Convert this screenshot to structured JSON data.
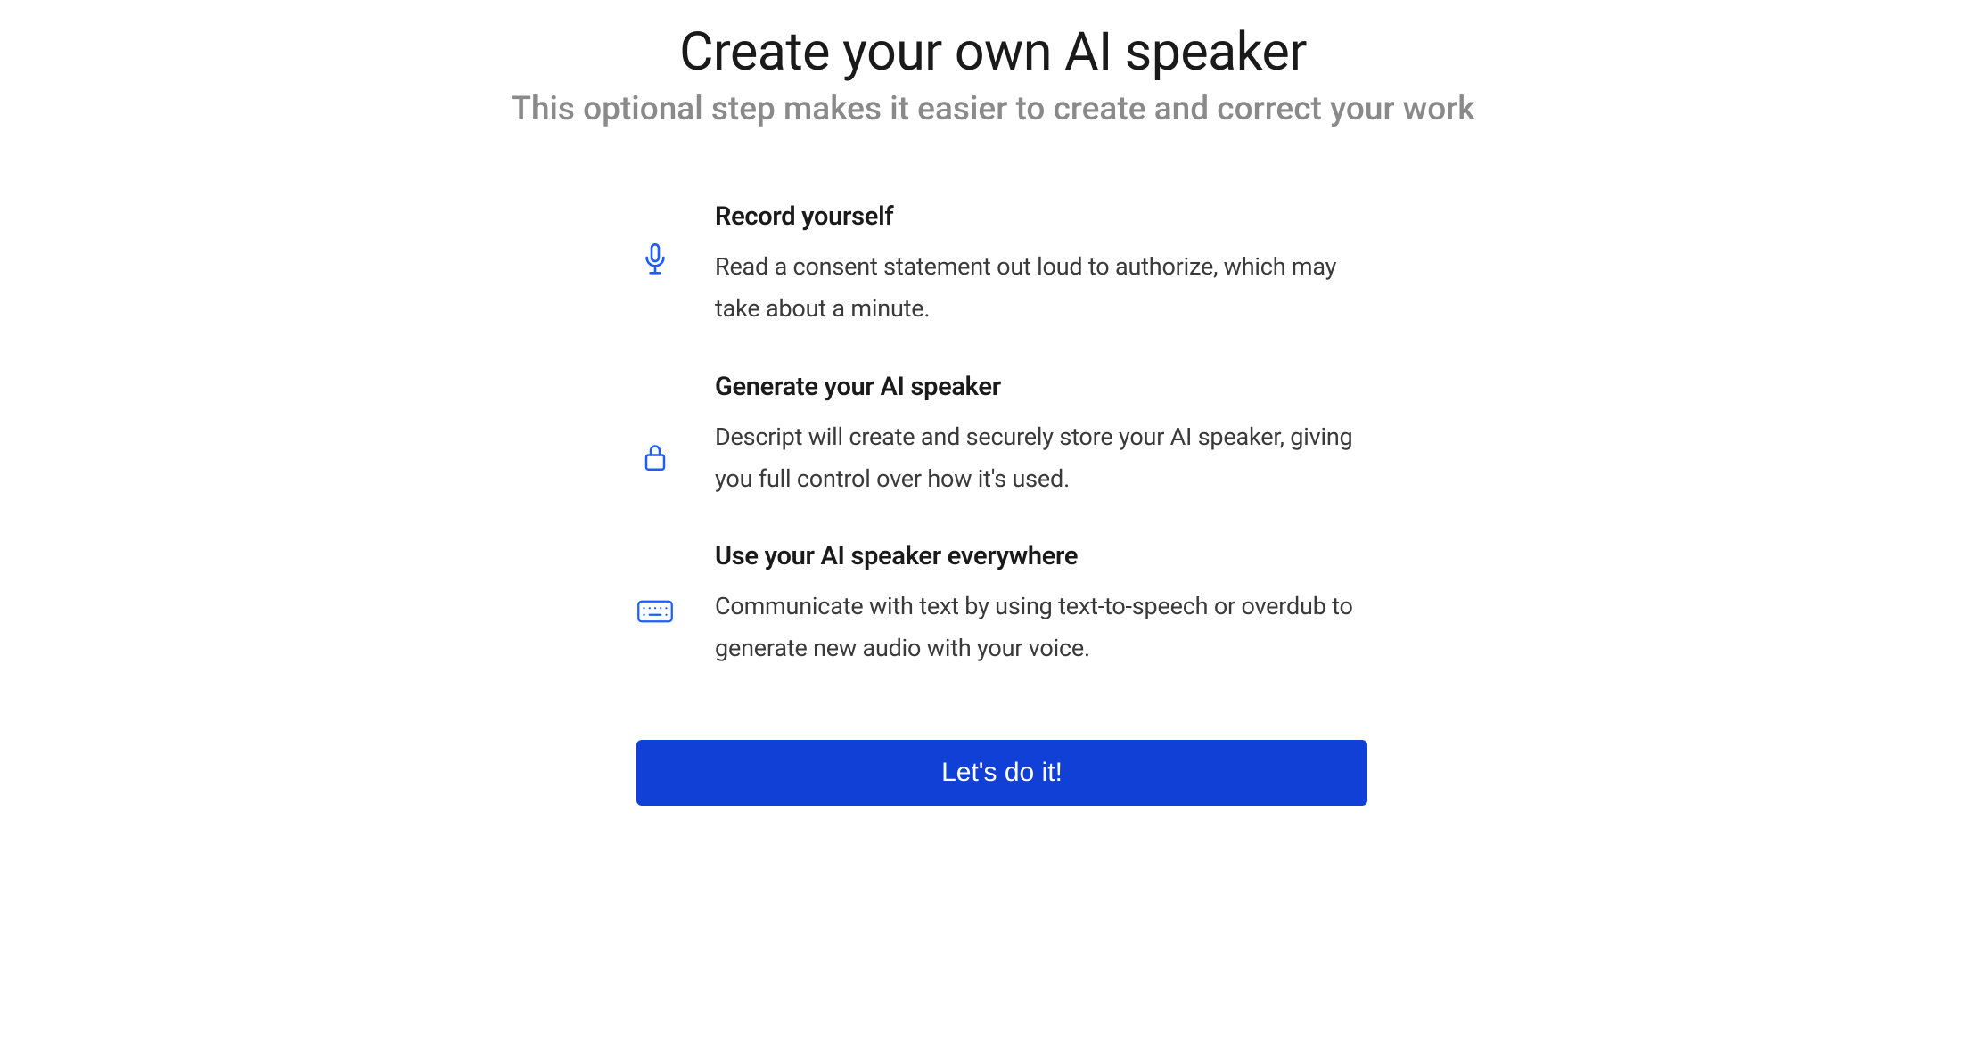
{
  "header": {
    "title": "Create your own AI speaker",
    "subtitle": "This optional step makes it easier to create and correct your work"
  },
  "steps": [
    {
      "icon": "microphone-icon",
      "title": "Record yourself",
      "description": "Read a consent statement out loud to authorize, which may take about a minute."
    },
    {
      "icon": "lock-icon",
      "title": "Generate your AI speaker",
      "description": "Descript will create and securely store your AI speaker, giving you full control over how it's used."
    },
    {
      "icon": "keyboard-icon",
      "title": "Use your AI speaker everywhere",
      "description": "Communicate with text by using text-to-speech or overdub to generate new audio with your voice."
    }
  ],
  "cta": {
    "label": "Let's do it!"
  },
  "colors": {
    "accent": "#1e5eff",
    "button": "#1040d6"
  }
}
